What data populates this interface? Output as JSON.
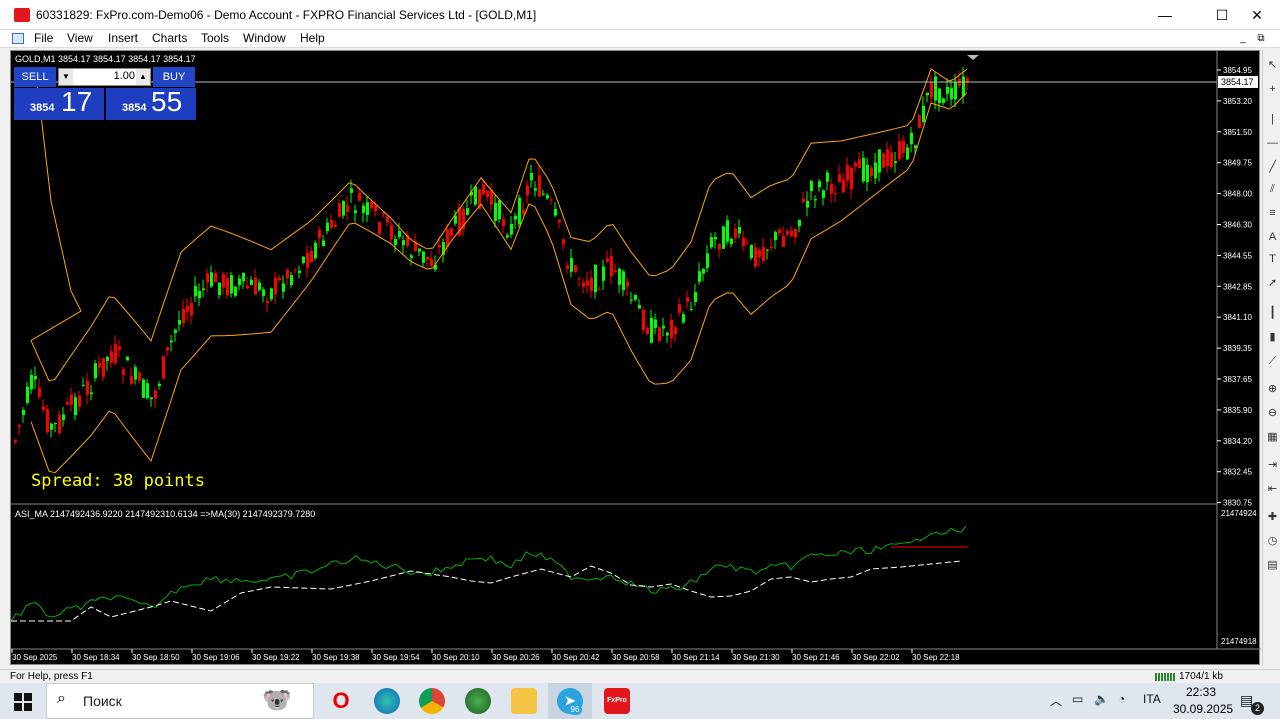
{
  "window": {
    "title": "60331829: FxPro.com-Demo06 - Demo Account - FXPRO Financial Services Ltd - [GOLD,M1]",
    "minimize": "—",
    "maximize": "☐",
    "close": "✕"
  },
  "menu": [
    "File",
    "View",
    "Insert",
    "Charts",
    "Tools",
    "Window",
    "Help"
  ],
  "chart": {
    "symbol_header": "GOLD,M1  3854.17 3854.17 3854.17 3854.17",
    "spread_label": "Spread: 38 points",
    "current_price": "3854.17",
    "price_axis": [
      "3854.95",
      "3853.20",
      "3851.50",
      "3849.75",
      "3848.00",
      "3846.30",
      "3844.55",
      "3842.85",
      "3841.10",
      "3839.35",
      "3837.65",
      "3835.90",
      "3834.20",
      "3832.45",
      "3830.75"
    ],
    "indicator_header": "ASI_MA 2147492436.9220 2147492310.6134 =>MA(30) 2147492379.7280",
    "indicator_axis_top": "21474924",
    "indicator_axis_bottom": "21474918",
    "time_axis": [
      "30 Sep 2025",
      "30 Sep 18:34",
      "30 Sep 18:50",
      "30 Sep 19:06",
      "30 Sep 19:22",
      "30 Sep 19:38",
      "30 Sep 19:54",
      "30 Sep 20:10",
      "30 Sep 20:26",
      "30 Sep 20:42",
      "30 Sep 20:58",
      "30 Sep 21:14",
      "30 Sep 21:30",
      "30 Sep 21:46",
      "30 Sep 22:02",
      "30 Sep 22:18"
    ],
    "colors": {
      "bull": "#00ff00",
      "bear": "#ff0000",
      "band": "#ffa500",
      "asi": "#00b000",
      "ma": "#ffffff",
      "signal": "#ff0000",
      "spread": "#ffff00"
    }
  },
  "trade_panel": {
    "sell_label": "SELL",
    "buy_label": "BUY",
    "lot": "1.00",
    "sell_small": "3854",
    "sell_big": "17",
    "buy_small": "3854",
    "buy_big": "55"
  },
  "status": {
    "help": "For Help, press F1",
    "traffic": "1704/1 kb"
  },
  "taskbar": {
    "search_placeholder": "Поиск",
    "telegram_badge": "96",
    "lang": "ITA",
    "time": "22:33",
    "date": "30.09.2025",
    "notif_count": "2"
  }
}
